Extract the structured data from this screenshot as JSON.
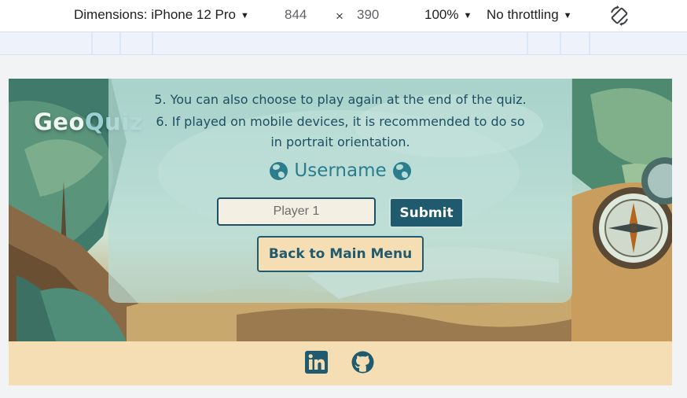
{
  "devtools": {
    "device_label": "Dimensions: iPhone 12 Pro",
    "width_value": "844",
    "times_symbol": "×",
    "height_value": "390",
    "zoom_label": "100%",
    "throttling_label": "No throttling",
    "icons": {
      "caret": "caret-down-icon",
      "rotate": "rotate-icon"
    }
  },
  "site": {
    "logo_geo": "Geo",
    "logo_quiz": "Quiz",
    "rules": {
      "rule5": "5. You can also choose to play again at the end of the quiz.",
      "rule6": "6. If played on mobile devices, it is recommended to do so in portrait orientation."
    },
    "username_heading": "Username",
    "username_placeholder": "Player 1",
    "submit_label": "Submit",
    "back_label": "Back to Main Menu",
    "footer_icons": [
      "linkedin-icon",
      "github-icon"
    ],
    "colors": {
      "accent": "#1f5a6e",
      "footer_bg": "#f5deb3",
      "text": "#1d4e63"
    }
  }
}
